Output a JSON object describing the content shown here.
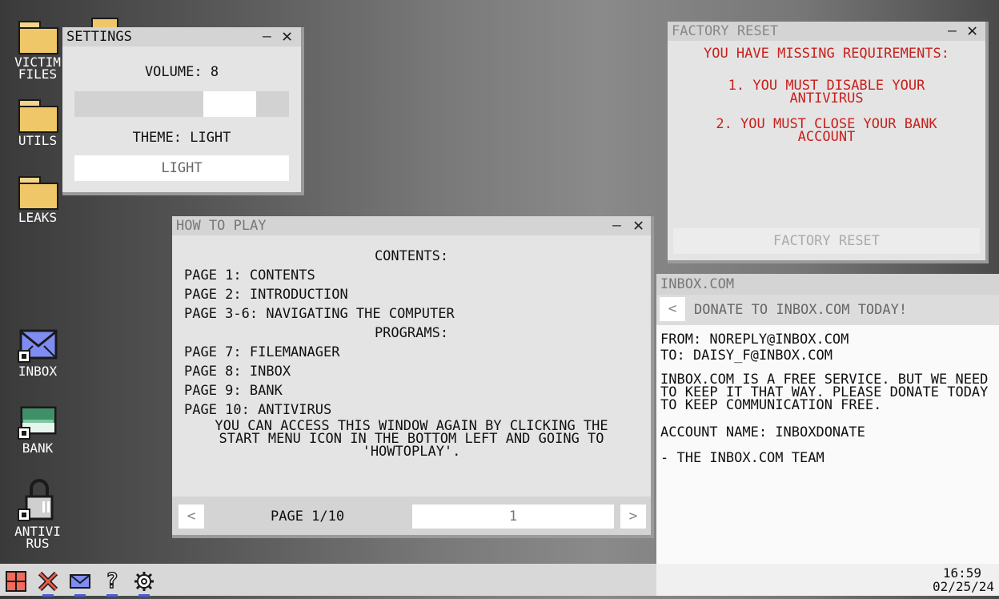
{
  "desktop": {
    "icons": [
      {
        "label": "VICTIM\nFILES",
        "icon": "folder-icon"
      },
      {
        "label": "UTILS",
        "icon": "folder-icon"
      },
      {
        "label": "LEAKS",
        "icon": "folder-icon"
      },
      {
        "label": "INBOX",
        "icon": "mail-icon"
      },
      {
        "label": "BANK",
        "icon": "bank-card-icon"
      },
      {
        "label": "ANTIVI\nRUS",
        "icon": "lock-icon"
      }
    ]
  },
  "settings": {
    "title": "SETTINGS",
    "volume_label": "VOLUME: 8",
    "volume_level": 0.8,
    "theme_label": "THEME: LIGHT",
    "theme_button": "LIGHT"
  },
  "howto": {
    "title": "HOW TO PLAY",
    "contents_heading": "CONTENTS:",
    "lines": [
      "PAGE 1: CONTENTS",
      "PAGE 2: INTRODUCTION",
      "PAGE 3-6: NAVIGATING THE COMPUTER"
    ],
    "programs_heading": "PROGRAMS:",
    "program_lines": [
      "PAGE 7: FILEMANAGER",
      "PAGE 8: INBOX",
      "PAGE 9: BANK",
      "PAGE 10: ANTIVIRUS"
    ],
    "note": "YOU CAN ACCESS THIS WINDOW AGAIN BY CLICKING THE START MENU ICON IN THE BOTTOM LEFT AND GOING TO 'HOWTOPLAY'.",
    "page_indicator": "PAGE 1/10",
    "page_input": "1",
    "prev": "<",
    "next": ">"
  },
  "factory_reset": {
    "title": "FACTORY RESET",
    "heading": "YOU HAVE MISSING REQUIREMENTS:",
    "req1": "1. YOU MUST DISABLE YOUR ANTIVIRUS",
    "req2": "2. YOU MUST CLOSE YOUR BANK ACCOUNT",
    "button": "FACTORY RESET"
  },
  "inbox": {
    "title": "INBOX.COM",
    "back": "<",
    "subject": "DONATE TO INBOX.COM TODAY!",
    "from": "FROM: NOREPLY@INBOX.COM",
    "to": "TO: DAISY_F@INBOX.COM",
    "body": "INBOX.COM IS A FREE SERVICE. BUT WE NEED TO KEEP IT THAT WAY. PLEASE DONATE TODAY TO KEEP COMMUNICATION FREE.",
    "account": "ACCOUNT NAME: INBOXDONATE",
    "signature": "- THE INBOX.COM TEAM"
  },
  "taskbar": {
    "time": "16:59",
    "date": "02/25/24",
    "icons": [
      "start-menu-icon",
      "close-x-icon",
      "mail-icon",
      "help-icon",
      "settings-gear-icon"
    ]
  },
  "colors": {
    "warning_red": "#c8201c",
    "accent_blue": "#4a5ad8"
  }
}
